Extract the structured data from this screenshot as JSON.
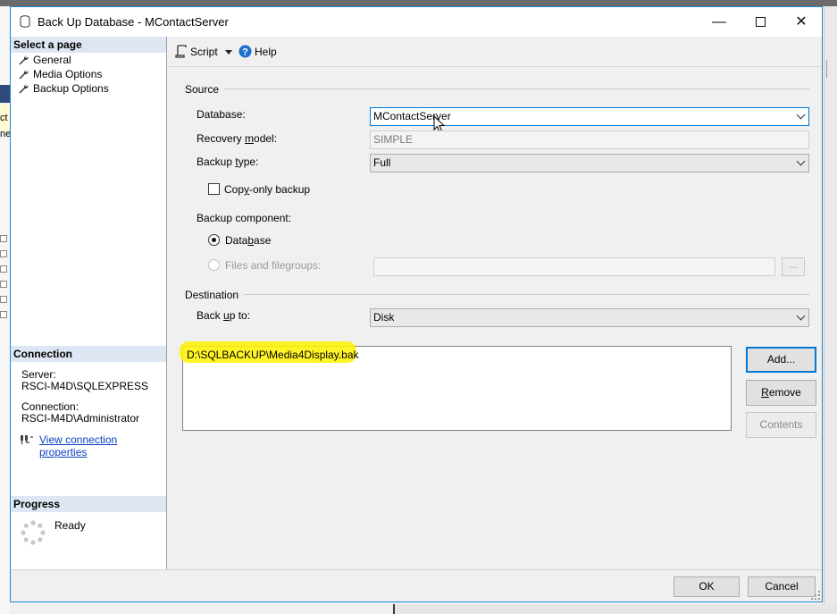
{
  "window": {
    "title": "Back Up Database - MContactServer",
    "minimize_glyph": "—",
    "close_glyph": "✕"
  },
  "background_app": {
    "fragment_1": "ct",
    "fragment_2": "ne"
  },
  "left_pane": {
    "select_page_header": "Select a page",
    "pages": [
      {
        "label": "General",
        "icon": "wrench-icon"
      },
      {
        "label": "Media Options",
        "icon": "wrench-icon"
      },
      {
        "label": "Backup Options",
        "icon": "wrench-icon"
      }
    ],
    "connection_header": "Connection",
    "server_label": "Server:",
    "server_value": "RSCI-M4D\\SQLEXPRESS",
    "connection_label": "Connection:",
    "connection_value": "RSCI-M4D\\Administrator",
    "view_connection_link": "View connection properties",
    "progress_header": "Progress",
    "progress_status": "Ready"
  },
  "toolbar": {
    "script_label": "Script",
    "help_label": "Help"
  },
  "source": {
    "group_label": "Source",
    "database_label": "Database:",
    "database_value": "MContactServer",
    "recovery_model_label_pre": "Recovery ",
    "recovery_model_label_u": "m",
    "recovery_model_label_post": "odel:",
    "recovery_model_value": "SIMPLE",
    "backup_type_label_pre": "Backup ",
    "backup_type_label_u": "t",
    "backup_type_label_post": "ype:",
    "backup_type_value": "Full",
    "copy_only_label_pre": "Cop",
    "copy_only_label_u": "y",
    "copy_only_label_post": "-only backup",
    "copy_only_checked": false,
    "backup_component_label": "Backup component:",
    "component_database_pre": "Data",
    "component_database_u": "b",
    "component_database_post": "ase",
    "component_files_label": "Files and filegroups:",
    "component_files_value": "",
    "browse_button": "..."
  },
  "destination": {
    "group_label": "Destination",
    "back_up_to_pre": "Back ",
    "back_up_to_u": "u",
    "back_up_to_post": "p to:",
    "back_up_to_value": "Disk",
    "paths": [
      "D:\\SQLBACKUP\\Media4Display.bak"
    ],
    "add_button": "Add...",
    "remove_button_u": "R",
    "remove_button_rest": "emove",
    "contents_button": "Contents"
  },
  "footer": {
    "ok_button": "OK",
    "cancel_button": "Cancel"
  },
  "colors": {
    "accent": "#0078d7",
    "section_header_bg": "#dde6f2",
    "highlight": "#fff200",
    "link": "#0a3fbf"
  }
}
